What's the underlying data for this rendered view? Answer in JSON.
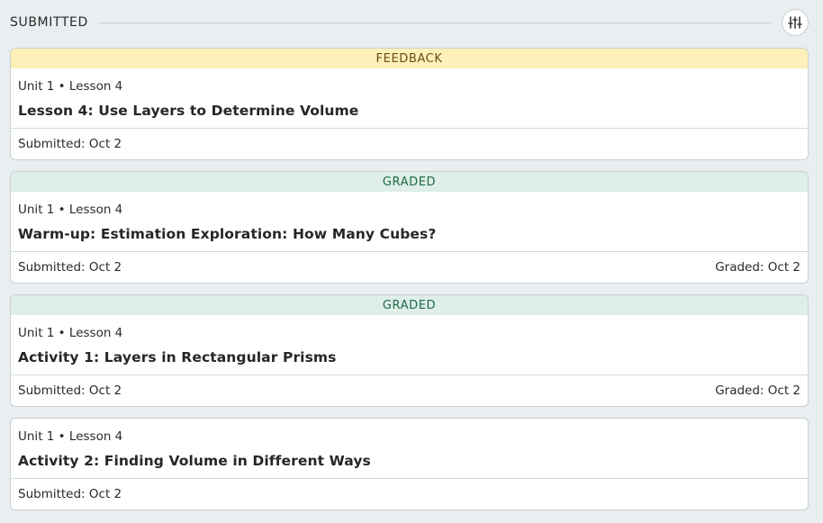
{
  "section": {
    "title": "SUBMITTED",
    "filter_icon": "sliders-icon"
  },
  "cards": [
    {
      "status": "FEEDBACK",
      "status_type": "feedback",
      "subtitle": "Unit 1 • Lesson 4",
      "title": "Lesson 4: Use Layers to Determine Volume",
      "submitted": "Submitted: Oct 2",
      "graded": ""
    },
    {
      "status": "GRADED",
      "status_type": "graded",
      "subtitle": "Unit 1 • Lesson 4",
      "title": "Warm-up: Estimation Exploration: How Many Cubes?",
      "submitted": "Submitted: Oct 2",
      "graded": "Graded: Oct 2"
    },
    {
      "status": "GRADED",
      "status_type": "graded",
      "subtitle": "Unit 1 • Lesson 4",
      "title": "Activity 1: Layers in Rectangular Prisms",
      "submitted": "Submitted: Oct 2",
      "graded": "Graded: Oct 2"
    },
    {
      "status": "",
      "status_type": "none",
      "subtitle": "Unit 1 • Lesson 4",
      "title": "Activity 2: Finding Volume in Different Ways",
      "submitted": "Submitted: Oct 2",
      "graded": ""
    }
  ],
  "colors": {
    "feedback_bg": "#fdf0b8",
    "feedback_text": "#6b4a12",
    "graded_bg": "#dfeee8",
    "graded_text": "#1d6b47",
    "page_bg": "#e9eef0"
  }
}
